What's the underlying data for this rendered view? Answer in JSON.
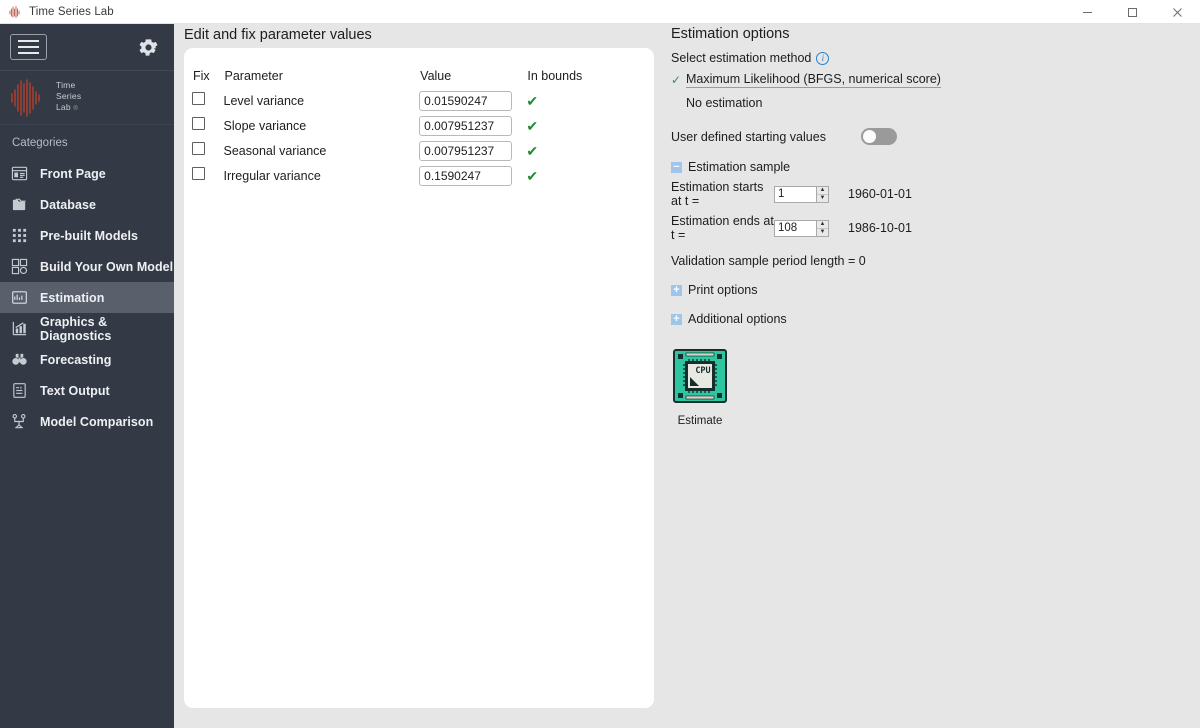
{
  "window": {
    "title": "Time Series Lab",
    "icon": "app-waveform-icon",
    "minimize": "–",
    "maximize": "☐",
    "close": "✕"
  },
  "sidebar": {
    "menu_button": "hamburger-menu",
    "settings_button": "gear-icon",
    "logo": {
      "line1": "Time",
      "line2": "Series",
      "line3": "Lab",
      "tm": "®"
    },
    "categories_label": "Categories",
    "items": [
      {
        "label": "Front Page",
        "icon": "front-page-icon",
        "active": false
      },
      {
        "label": "Database",
        "icon": "database-icon",
        "active": false
      },
      {
        "label": "Pre-built Models",
        "icon": "grid-dots-icon",
        "active": false
      },
      {
        "label": "Build Your Own Model",
        "icon": "build-model-icon",
        "active": false
      },
      {
        "label": "Estimation",
        "icon": "estimation-icon",
        "active": true
      },
      {
        "label": "Graphics & Diagnostics",
        "icon": "bar-chart-icon",
        "active": false
      },
      {
        "label": "Forecasting",
        "icon": "binoculars-icon",
        "active": false
      },
      {
        "label": "Text Output",
        "icon": "text-output-icon",
        "active": false
      },
      {
        "label": "Model Comparison",
        "icon": "model-comparison-icon",
        "active": false
      }
    ]
  },
  "main": {
    "panel_title": "Edit and fix parameter values",
    "table": {
      "headers": [
        "Fix",
        "Parameter",
        "Value",
        "In bounds"
      ],
      "rows": [
        {
          "fix": false,
          "parameter": "Level variance",
          "value": "0.01590247",
          "in_bounds": "✔"
        },
        {
          "fix": false,
          "parameter": "Slope variance",
          "value": "0.007951237",
          "in_bounds": "✔"
        },
        {
          "fix": false,
          "parameter": "Seasonal variance",
          "value": "0.007951237",
          "in_bounds": "✔"
        },
        {
          "fix": false,
          "parameter": "Irregular variance",
          "value": "0.1590247",
          "in_bounds": "✔"
        }
      ]
    }
  },
  "options": {
    "title": "Estimation options",
    "method_label": "Select estimation method",
    "info_icon": "i",
    "methods": [
      {
        "label": "Maximum Likelihood (BFGS, numerical score)",
        "selected": true,
        "check": "✓"
      },
      {
        "label": "No estimation",
        "selected": false,
        "check": ""
      }
    ],
    "user_defined_label": "User defined starting values",
    "user_defined_on": false,
    "estimation_sample": {
      "expander_sign": "−",
      "expander_label": "Estimation sample",
      "start_label": "Estimation starts at t =",
      "start_value": "1",
      "start_date": "1960-01-01",
      "end_label": "Estimation ends at t =",
      "end_value": "108",
      "end_date": "1986-10-01",
      "validation_text": "Validation sample period length = 0"
    },
    "print_options": {
      "expander_sign": "+",
      "label": "Print options"
    },
    "additional_options": {
      "expander_sign": "+",
      "label": "Additional options"
    },
    "estimate": {
      "icon": "cpu-chip-icon",
      "icon_text": "CPU",
      "label": "Estimate"
    }
  },
  "colors": {
    "sidebar_bg": "#333a45",
    "sidebar_active": "#59606c",
    "main_bg": "#e6e6e6",
    "card_bg": "#ffffff",
    "tick_green": "#1f8a30",
    "accent_blue": "#9fc5ea",
    "chip_teal": "#2ec6a0",
    "logo_red": "#b4412e"
  }
}
